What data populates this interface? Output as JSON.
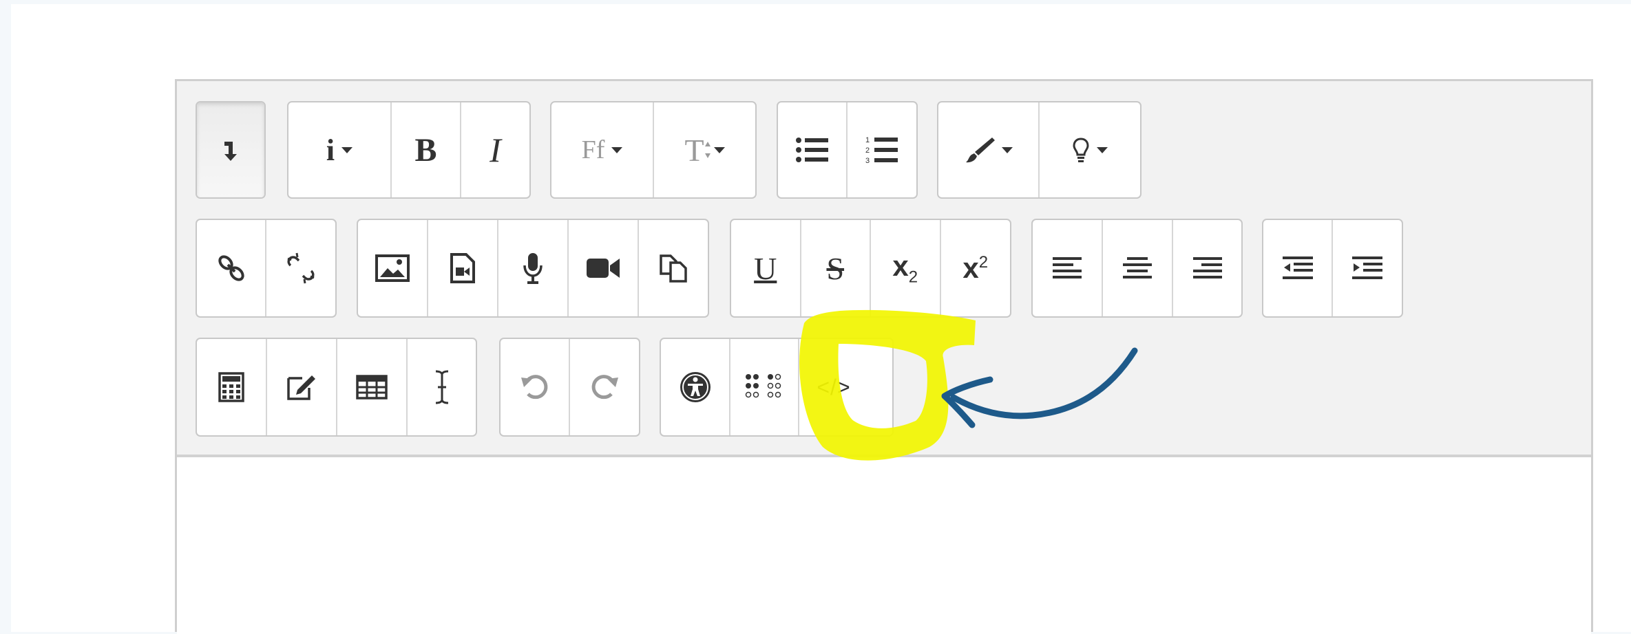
{
  "editor": {
    "rows": [
      {
        "groups": [
          {
            "buttons": [
              {
                "name": "show-more-buttons-button",
                "icon": "collapse-arrow-icon",
                "pressed": true
              }
            ]
          },
          {
            "buttons": [
              {
                "name": "info-dropdown-button",
                "icon": "info-icon",
                "label": "i",
                "dropdown": true
              },
              {
                "name": "bold-button",
                "icon": "bold-icon",
                "label": "B"
              },
              {
                "name": "italic-button",
                "icon": "italic-icon",
                "label": "I"
              }
            ]
          },
          {
            "buttons": [
              {
                "name": "font-family-button",
                "icon": "font-family-icon",
                "label": "Ff",
                "dropdown": true
              },
              {
                "name": "font-size-button",
                "icon": "font-size-icon",
                "label": "T",
                "dropdown": true
              }
            ]
          },
          {
            "buttons": [
              {
                "name": "unordered-list-button",
                "icon": "bullet-list-icon"
              },
              {
                "name": "ordered-list-button",
                "icon": "numbered-list-icon"
              }
            ]
          },
          {
            "buttons": [
              {
                "name": "font-color-button",
                "icon": "brush-icon",
                "dropdown": true
              },
              {
                "name": "background-color-button",
                "icon": "lightbulb-icon",
                "dropdown": true
              }
            ]
          }
        ]
      },
      {
        "groups": [
          {
            "buttons": [
              {
                "name": "link-button",
                "icon": "link-icon"
              },
              {
                "name": "unlink-button",
                "icon": "unlink-icon"
              }
            ]
          },
          {
            "buttons": [
              {
                "name": "insert-image-button",
                "icon": "image-icon"
              },
              {
                "name": "insert-media-button",
                "icon": "media-file-icon"
              },
              {
                "name": "record-audio-button",
                "icon": "microphone-icon"
              },
              {
                "name": "record-video-button",
                "icon": "video-camera-icon"
              },
              {
                "name": "manage-files-button",
                "icon": "files-icon"
              }
            ]
          },
          {
            "buttons": [
              {
                "name": "underline-button",
                "icon": "underline-icon",
                "label": "U"
              },
              {
                "name": "strikethrough-button",
                "icon": "strikethrough-icon",
                "label": "S"
              },
              {
                "name": "subscript-button",
                "icon": "subscript-icon",
                "label": "x",
                "sub": "2"
              },
              {
                "name": "superscript-button",
                "icon": "superscript-icon",
                "label": "x",
                "sup": "2"
              }
            ]
          },
          {
            "buttons": [
              {
                "name": "align-left-button",
                "icon": "align-left-icon"
              },
              {
                "name": "align-center-button",
                "icon": "align-center-icon"
              },
              {
                "name": "align-right-button",
                "icon": "align-right-icon"
              }
            ]
          },
          {
            "buttons": [
              {
                "name": "outdent-button",
                "icon": "outdent-icon"
              },
              {
                "name": "indent-button",
                "icon": "indent-icon"
              }
            ]
          }
        ]
      },
      {
        "groups": [
          {
            "buttons": [
              {
                "name": "equation-editor-button",
                "icon": "calculator-icon"
              },
              {
                "name": "insert-character-button",
                "icon": "edit-icon"
              },
              {
                "name": "insert-table-button",
                "icon": "table-icon"
              },
              {
                "name": "clear-formatting-button",
                "icon": "text-cursor-icon"
              }
            ]
          },
          {
            "buttons": [
              {
                "name": "undo-button",
                "icon": "undo-icon"
              },
              {
                "name": "redo-button",
                "icon": "redo-icon"
              }
            ]
          },
          {
            "buttons": [
              {
                "name": "accessibility-checker-button",
                "icon": "accessibility-icon"
              },
              {
                "name": "screenreader-helper-button",
                "icon": "braille-icon"
              },
              {
                "name": "html-button",
                "icon": "code-icon",
                "label": "</>"
              }
            ]
          }
        ]
      }
    ]
  },
  "colors": {
    "highlight": "#f2f500",
    "arrow": "#1e5a8a"
  }
}
